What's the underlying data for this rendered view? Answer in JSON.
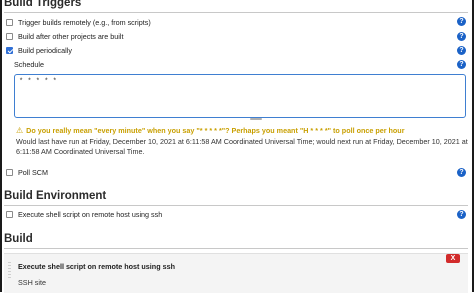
{
  "build_triggers": {
    "title": "Build Triggers",
    "options": [
      {
        "label": "Trigger builds remotely (e.g., from scripts)",
        "checked": false
      },
      {
        "label": "Build after other projects are built",
        "checked": false
      },
      {
        "label": "Build periodically",
        "checked": true
      }
    ],
    "schedule": {
      "label": "Schedule",
      "value": "* * * * *",
      "warning": "Do you really mean \"every minute\" when you say \"* * * * *\"? Perhaps you meant \"H * * * *\" to poll once per hour",
      "info_line1": "Would last have run at Friday, December 10, 2021 at 6:11:58 AM Coordinated Universal Time; would next run at Friday, December 10, 2021 at",
      "info_line2": "6:11:58 AM Coordinated Universal Time."
    },
    "poll_scm": {
      "label": "Poll SCM",
      "checked": false
    }
  },
  "build_environment": {
    "title": "Build Environment",
    "options": [
      {
        "label": "Execute shell script on remote host using ssh",
        "checked": false
      }
    ]
  },
  "build": {
    "title": "Build",
    "step_title": "Execute shell script on remote host using ssh",
    "step_sub": "SSH site",
    "delete_label": "X"
  },
  "help_glyph": "?",
  "colors": {
    "accent": "#1b62c7",
    "warning": "#c9a003",
    "delete": "#d22b2b"
  }
}
